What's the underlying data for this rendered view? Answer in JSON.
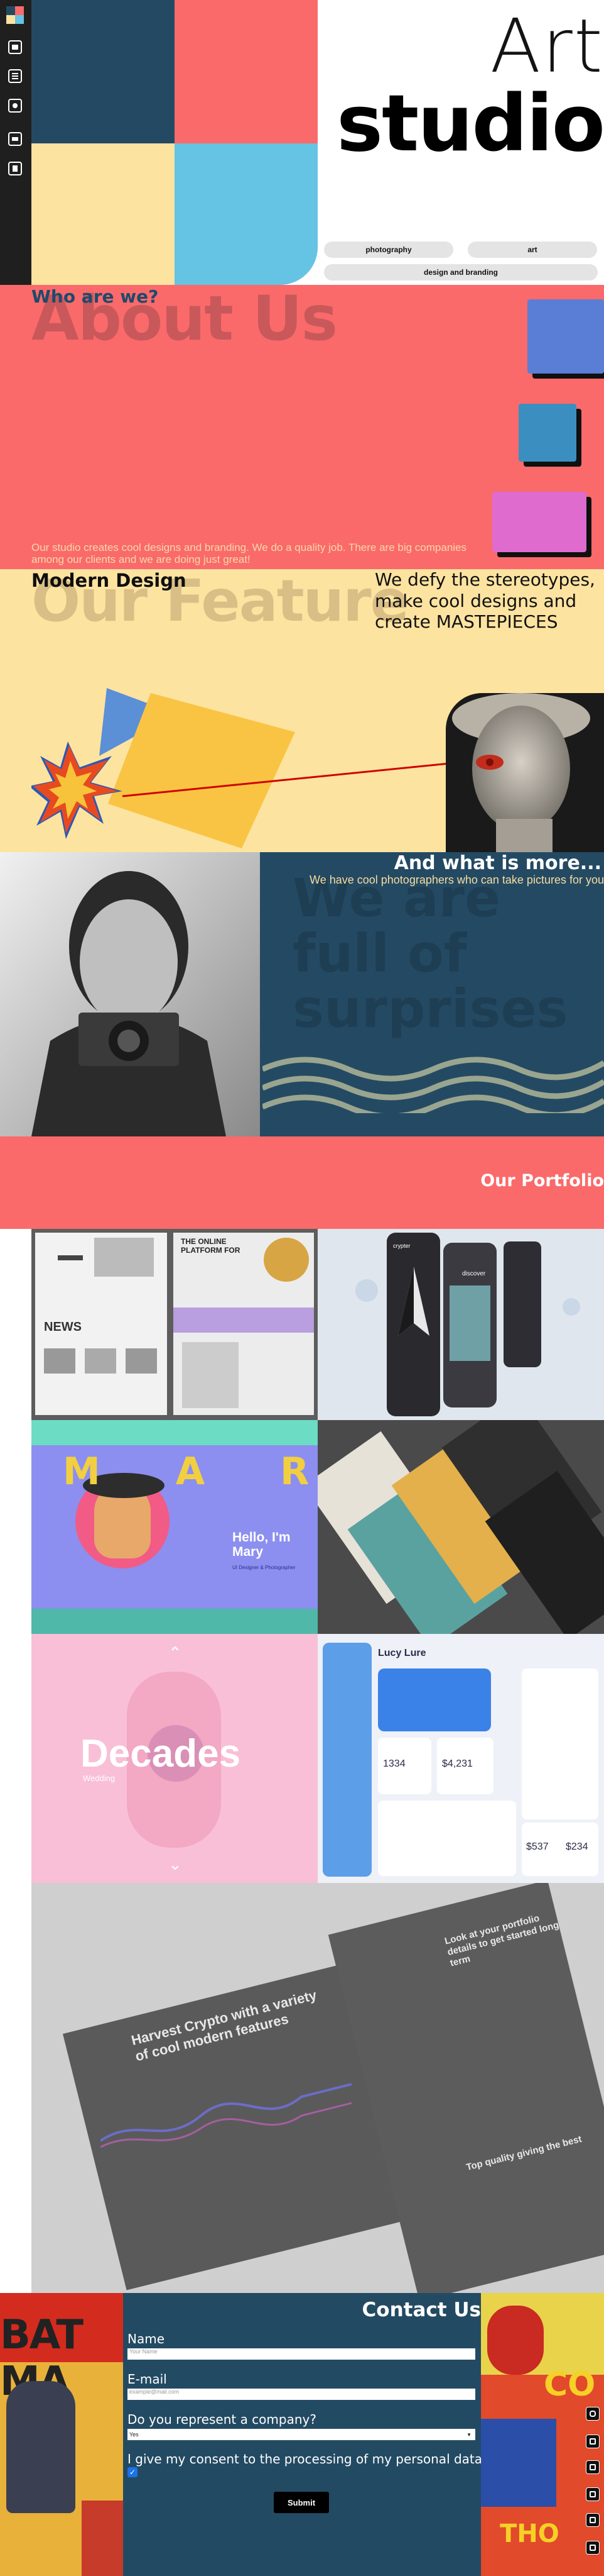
{
  "hero": {
    "title_line1": "Art",
    "title_line2": "studio",
    "tags": [
      "photography",
      "art",
      "design and branding"
    ]
  },
  "sidebar": {
    "icons": [
      "logo-icon",
      "photo-icon",
      "list-icon",
      "camera-icon",
      "image-icon",
      "document-icon"
    ]
  },
  "about": {
    "question": "Who are we?",
    "title": "About Us",
    "text": "Our studio creates cool designs and branding. We do a quality job. There are big companies among our clients and we are doing just great!"
  },
  "feature": {
    "heading": "Modern Design",
    "title": "Our Feature",
    "tagline": "We defy the stereotypes, make cool designs and create MASTEPIECES"
  },
  "surprise": {
    "heading": "And what is more...",
    "subtext": "We have cool photographers who can take pictures for you",
    "background_text": "We are full of surprises"
  },
  "portfolio": {
    "title": "Our Portfolio",
    "tiles": {
      "t1_platform": "THE ONLINE PLATFORM FOR",
      "t1_news": "NEWS",
      "t2_title": "crypter",
      "t2_discover": "discover",
      "t3_name": "MARY",
      "t3_greeting": "Hello, I'm Mary",
      "t3_role": "UI Designer & Photographer",
      "t5_title": "Decades",
      "t5_sub": "Wedding",
      "t6_user": "Lucy Lure",
      "t6_nums": [
        "1334",
        "$4,231",
        "$537",
        "$234"
      ],
      "t7_title": "Harvest Crypto with a variety of cool modern features",
      "t7_right1": "Look at your portfolio details to get started long term",
      "t7_right2": "Top quality giving the best"
    }
  },
  "contact": {
    "title": "Contact Us",
    "name_label": "Name",
    "name_placeholder": "Your Name",
    "email_label": "E-mail",
    "email_placeholder": "example@mail.com",
    "company_label": "Do you represent a company?",
    "company_value": "Yes",
    "consent_label": "I give my consent to the processing of my personal data",
    "submit": "Submit"
  },
  "colors": {
    "coral": "#fa6a6a",
    "navy": "#244a63",
    "cream": "#fde3a0",
    "sky": "#65c3e3",
    "dark": "#1f1f1f"
  }
}
